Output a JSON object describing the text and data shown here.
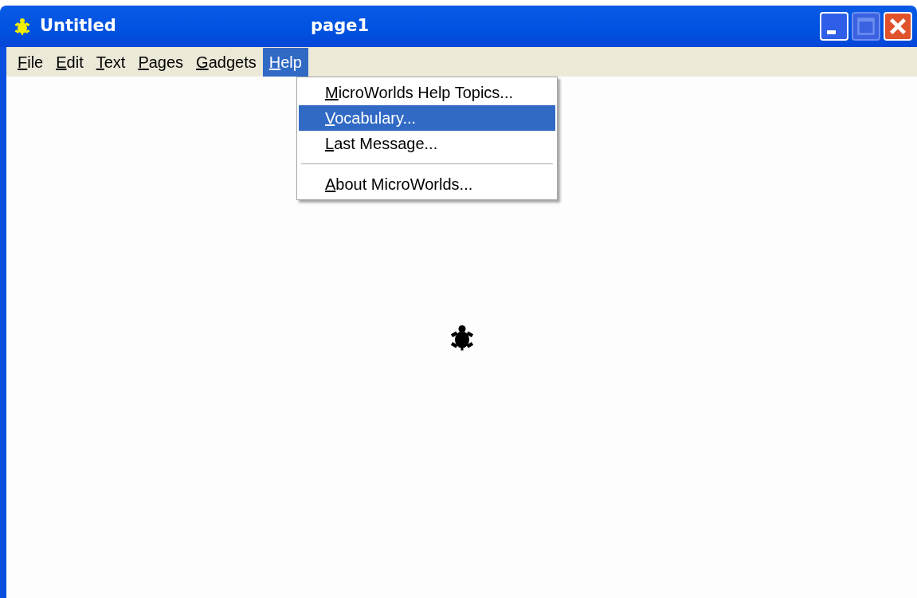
{
  "window": {
    "title": "Untitled",
    "page": "page1",
    "buttons": [
      {
        "kind": "minimize",
        "disabled": false
      },
      {
        "kind": "maximize",
        "disabled": true
      },
      {
        "kind": "close",
        "disabled": false
      }
    ]
  },
  "menu_bar": [
    {
      "label": "File",
      "selected": false,
      "mnemonic": true
    },
    {
      "label": "Edit",
      "selected": false,
      "mnemonic": true
    },
    {
      "label": "Text",
      "selected": false,
      "mnemonic": true
    },
    {
      "label": "Pages",
      "selected": false,
      "mnemonic": true
    },
    {
      "label": "Gadgets",
      "selected": false,
      "mnemonic": true
    },
    {
      "label": "Help",
      "selected": true,
      "mnemonic": true
    }
  ],
  "help_menu": [
    {
      "kind": "item",
      "label": "MicroWorlds Help Topics...",
      "selected": false,
      "mnemonic": true
    },
    {
      "kind": "item",
      "label": "Vocabulary...",
      "selected": true,
      "mnemonic": true
    },
    {
      "kind": "item",
      "label": "Last Message...",
      "selected": false,
      "mnemonic": true
    },
    {
      "kind": "separator"
    },
    {
      "kind": "item",
      "label": "About MicroWorlds...",
      "selected": false,
      "mnemonic": true
    }
  ]
}
